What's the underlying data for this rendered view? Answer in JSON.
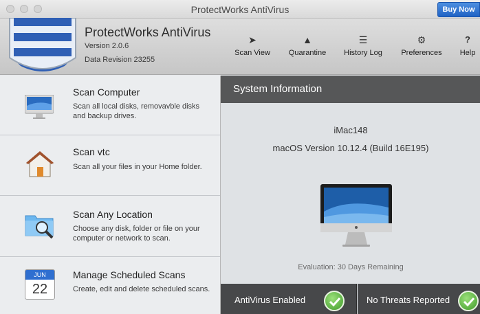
{
  "window": {
    "title": "ProtectWorks AntiVirus",
    "buy_label": "Buy Now"
  },
  "app": {
    "name": "ProtectWorks AntiVirus",
    "version": "Version 2.0.6",
    "data_revision": "Data Revision 23255"
  },
  "toolbar": [
    {
      "label": "Scan View",
      "icon": "play-icon"
    },
    {
      "label": "Quarantine",
      "icon": "biohazard-icon"
    },
    {
      "label": "History Log",
      "icon": "list-icon"
    },
    {
      "label": "Preferences",
      "icon": "gear-icon"
    },
    {
      "label": "Help",
      "icon": "question-icon"
    }
  ],
  "scan_options": [
    {
      "title": "Scan Computer",
      "desc": "Scan all local disks, removavble disks and backup drives.",
      "icon": "imac-icon"
    },
    {
      "title": "Scan vtc",
      "desc": "Scan all your files in your Home folder.",
      "icon": "home-icon"
    },
    {
      "title": "Scan Any Location",
      "desc": "Choose any disk, folder or file on your computer or network to scan.",
      "icon": "folder-search-icon"
    },
    {
      "title": "Manage Scheduled Scans",
      "desc": "Create, edit and delete scheduled scans.",
      "icon": "calendar-icon",
      "calendar": {
        "month": "JUN",
        "day": "22"
      }
    }
  ],
  "system_info": {
    "header": "System Information",
    "model": "iMac148",
    "os_version": "macOS Version 10.12.4 (Build 16E195)",
    "evaluation": "Evaluation: 30 Days Remaining"
  },
  "status": [
    {
      "label": "AntiVirus Enabled"
    },
    {
      "label": "No Threats Reported"
    }
  ],
  "colors": {
    "accent": "#1f62c4",
    "status_bar": "#47484a",
    "check_green": "#3f9a2a"
  }
}
